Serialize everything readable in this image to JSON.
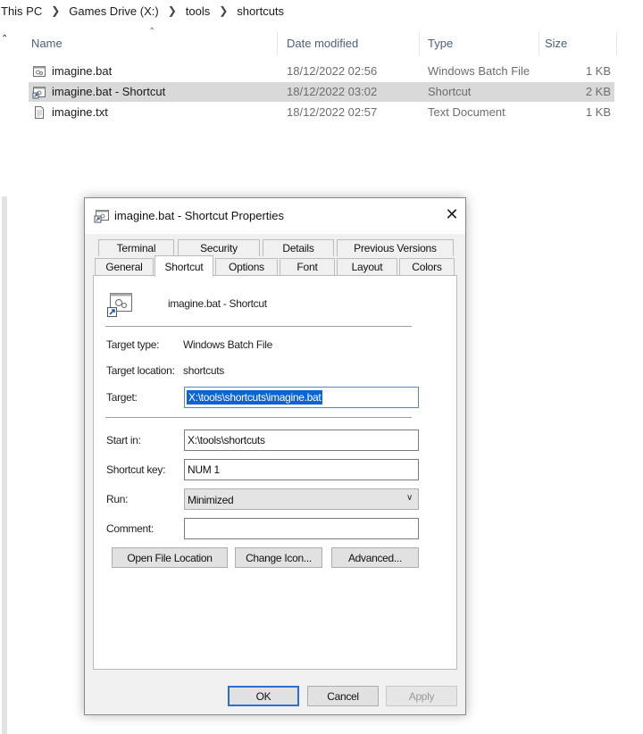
{
  "breadcrumb": [
    "This PC",
    "Games Drive (X:)",
    "tools",
    "shortcuts"
  ],
  "columns": {
    "name": "Name",
    "date": "Date modified",
    "type": "Type",
    "size": "Size"
  },
  "files": [
    {
      "name": "imagine.bat",
      "date": "18/12/2022 02:56",
      "type": "Windows Batch File",
      "size": "1 KB",
      "icon": "batch-file-icon"
    },
    {
      "name": "imagine.bat - Shortcut",
      "date": "18/12/2022 03:02",
      "type": "Shortcut",
      "size": "2 KB",
      "icon": "shortcut-icon"
    },
    {
      "name": "imagine.txt",
      "date": "18/12/2022 02:57",
      "type": "Text Document",
      "size": "1 KB",
      "icon": "text-file-icon"
    }
  ],
  "dialog": {
    "title": "imagine.bat - Shortcut Properties",
    "close": "✕",
    "tabs_back": [
      "Terminal",
      "Security",
      "Details",
      "Previous Versions"
    ],
    "tabs_front": [
      "General",
      "Shortcut",
      "Options",
      "Font",
      "Layout",
      "Colors"
    ],
    "active_tab": "Shortcut",
    "shortcut_name": "imagine.bat - Shortcut",
    "target_type_label": "Target type:",
    "target_type_value": "Windows Batch File",
    "target_location_label": "Target location:",
    "target_location_value": "shortcuts",
    "target_label": "Target:",
    "target_value": "X:\\tools\\shortcuts\\imagine.bat",
    "start_in_label": "Start in:",
    "start_in_value": "X:\\tools\\shortcuts",
    "shortcut_key_label": "Shortcut key:",
    "shortcut_key_value": "NUM 1",
    "run_label": "Run:",
    "run_value": "Minimized",
    "comment_label": "Comment:",
    "comment_value": "",
    "open_file_location": "Open File Location",
    "change_icon": "Change Icon...",
    "advanced": "Advanced...",
    "ok": "OK",
    "cancel": "Cancel",
    "apply": "Apply"
  }
}
